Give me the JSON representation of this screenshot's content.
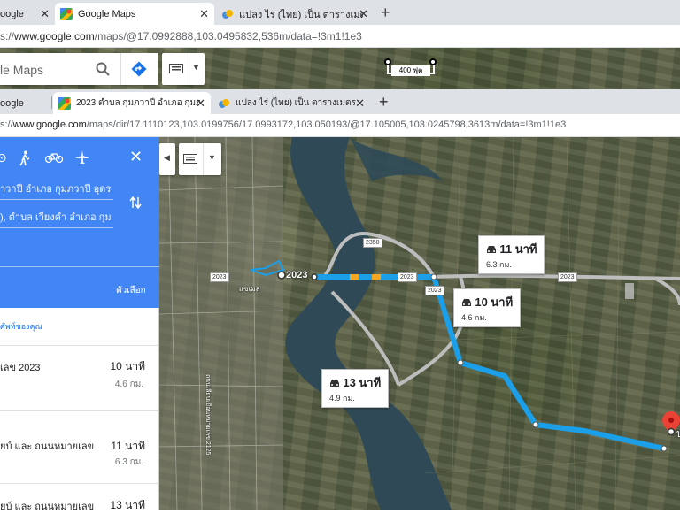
{
  "back_window": {
    "tabs": [
      {
        "label": "oogle"
      },
      {
        "label": "Google Maps"
      },
      {
        "label": "แปลง ไร่ (ไทย) เป็น ตารางเมตร (ตร.ม.)"
      }
    ],
    "url_prefix": "s://",
    "url_host": "www.google.com",
    "url_path": "/maps/@17.0992888,103.0495832,536m/data=!3m1!1e3",
    "search_placeholder": "le Maps",
    "scale_label": "400 ฟุต"
  },
  "front_window": {
    "tabs": [
      {
        "label": "oogle"
      },
      {
        "label": "2023 ตำบล กุมภวาปี อำเภอ กุมภวาปี อุ"
      },
      {
        "label": "แปลง ไร่ (ไทย) เป็น ตารางเมตร (ตร.ม.)"
      }
    ],
    "url_prefix": "s://",
    "url_host": "www.google.com",
    "url_path": "/maps/dir/17.1110123,103.0199756/17.0993172,103.050193/@17.105005,103.0245798,3613m/data=!3m1!1e3"
  },
  "directions": {
    "origin": "าวาปี อำเภอ กุมภวาปี อุดร",
    "destination": "), ตำบล เวียงคำ อำเภอ กุม",
    "options_label": "ตัวเลือก",
    "details_link": "ศัพท์ของคุณ",
    "routes": [
      {
        "name": "เลข 2023",
        "time": "10 นาที",
        "dist": "4.6 กม."
      },
      {
        "name": "ยบ์ และ ถนนหมายเลข",
        "time": "11 นาที",
        "dist": "6.3 กม."
      },
      {
        "name": "ยบ์ และ ถนนหมายเลข",
        "time": "13 นาที",
        "dist": ""
      }
    ]
  },
  "map": {
    "bubbles": [
      {
        "time": "11 นาที",
        "dist": "6.3 กม."
      },
      {
        "time": "10 นาที",
        "dist": "4.6 กม."
      },
      {
        "time": "13 นาที",
        "dist": "4.9 กม."
      }
    ],
    "road_signs": [
      "2350",
      "2023",
      "2023",
      "2023",
      "2023"
    ],
    "place_label": "2023",
    "river_label": "ถนนเลียบเขื่อนหมายเลข 2125",
    "town_label": "แซเมล",
    "dest_label": "บ"
  },
  "colors": {
    "accent": "#4285f4",
    "route": "#1a9fe8",
    "alt_route": "#bdbdbd",
    "water": "#2f4a56"
  }
}
